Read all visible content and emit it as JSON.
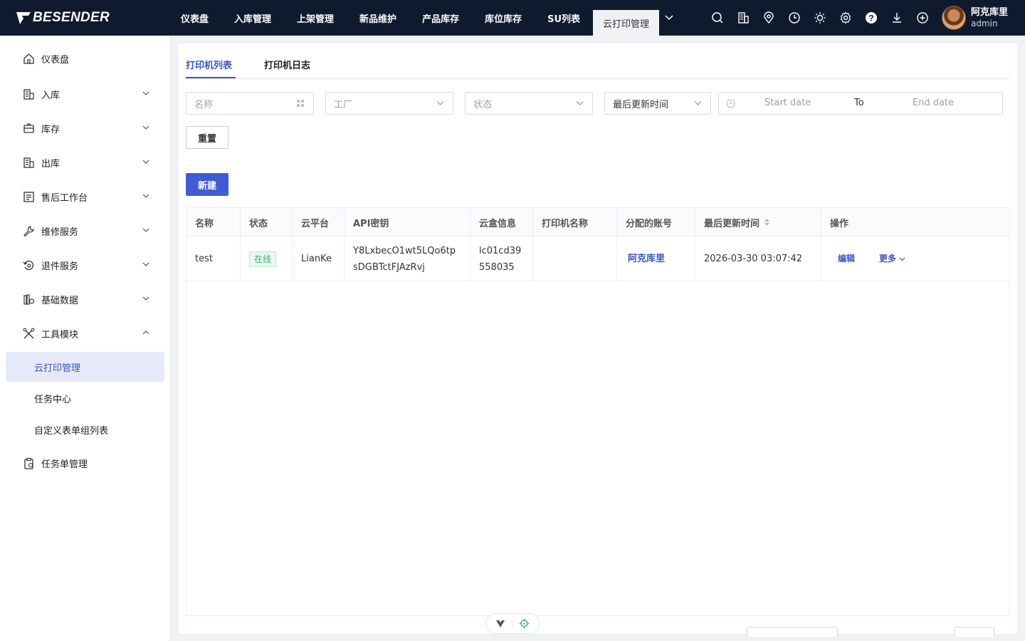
{
  "brand": {
    "name": "BESENDER"
  },
  "nav": {
    "items": [
      "仪表盘",
      "入库管理",
      "上架管理",
      "新品维护",
      "产品库存",
      "库位库存",
      "SU列表"
    ],
    "active": "云打印管理"
  },
  "user": {
    "name": "阿克库里",
    "role": "admin"
  },
  "sidebar": {
    "items": [
      {
        "label": "仪表盘",
        "icon": "home-icon"
      },
      {
        "label": "入库",
        "icon": "building-in-icon"
      },
      {
        "label": "库存",
        "icon": "storage-icon"
      },
      {
        "label": "出库",
        "icon": "building-out-icon"
      },
      {
        "label": "售后工作台",
        "icon": "aftersales-icon"
      },
      {
        "label": "维修服务",
        "icon": "wrench-icon"
      },
      {
        "label": "退件服务",
        "icon": "return-icon"
      },
      {
        "label": "基础数据",
        "icon": "database-icon"
      },
      {
        "label": "工具模块",
        "icon": "tools-icon"
      }
    ],
    "sub_items": [
      "云打印管理",
      "任务中心",
      "自定义表单组列表"
    ],
    "last_item": {
      "label": "任务单管理",
      "icon": "task-icon"
    }
  },
  "tabs": [
    "打印机列表",
    "打印机日志"
  ],
  "filters": {
    "name_placeholder": "名称",
    "factory_placeholder": "工厂",
    "status_placeholder": "状态",
    "time_select": "最后更新时间",
    "start_date": "Start date",
    "to": "To",
    "end_date": "End date"
  },
  "buttons": {
    "reset": "重置",
    "new": "新建"
  },
  "table": {
    "columns": [
      "名称",
      "状态",
      "云平台",
      "API密钥",
      "云盒信息",
      "打印机名称",
      "分配的账号",
      "最后更新时间",
      "操作"
    ],
    "rows": [
      {
        "name": "test",
        "status": "在线",
        "platform": "LianKe",
        "api_key_1": "Y8LxbecO1wt5LQo6tp",
        "api_key_2": "sDGBTctFJAzRvj",
        "box_1": "lc01cd39",
        "box_2": "558035",
        "printer": "",
        "account": "阿克库里",
        "updated": "2026-03-30 03:07:42",
        "edit": "编辑",
        "more": "更多"
      }
    ]
  },
  "colors": {
    "primary": "#3f5cd6",
    "topbar": "#0f1a2e",
    "online": "#3fae7e"
  }
}
